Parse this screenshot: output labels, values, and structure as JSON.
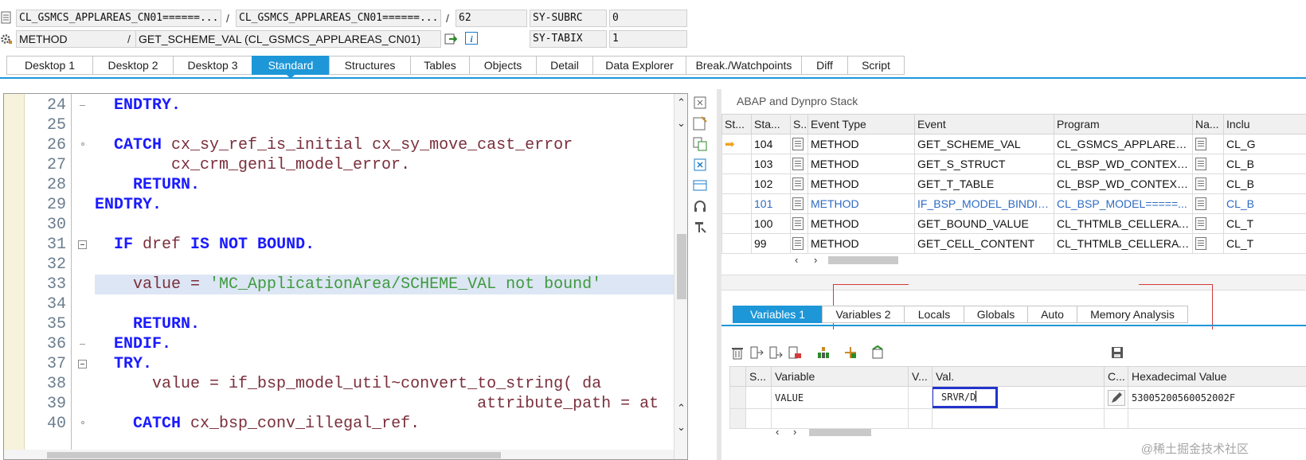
{
  "header": {
    "row1": {
      "program1": "CL_GSMCS_APPLAREAS_CN01======...",
      "slash1": "/",
      "program2": "CL_GSMCS_APPLAREAS_CN01======...",
      "slash2": "/",
      "line_no": "62",
      "sysvar_label": "SY-SUBRC",
      "sysvar_value": "0"
    },
    "row2": {
      "type": "METHOD",
      "slash": "/",
      "method": "GET_SCHEME_VAL (CL_GSMCS_APPLAREAS_CN01)",
      "sysvar_label": "SY-TABIX",
      "sysvar_value": "1"
    }
  },
  "tabs": [
    "Desktop 1",
    "Desktop 2",
    "Desktop 3",
    "Standard",
    "Structures",
    "Tables",
    "Objects",
    "Detail",
    "Data Explorer",
    "Break./Watchpoints",
    "Diff",
    "Script"
  ],
  "active_tab": "Standard",
  "editor": {
    "lines": [
      {
        "n": "24",
        "indent": "  ",
        "parts": [
          {
            "t": "ENDTRY",
            "c": "kw"
          },
          {
            "t": ".",
            "c": "kw"
          }
        ]
      },
      {
        "n": "25",
        "indent": "",
        "parts": []
      },
      {
        "n": "26",
        "indent": "  ",
        "parts": [
          {
            "t": "CATCH",
            "c": "kw"
          },
          {
            "t": " cx_sy_ref_is_initial cx_sy_move_cast_error",
            "c": "id"
          }
        ]
      },
      {
        "n": "27",
        "indent": "        ",
        "parts": [
          {
            "t": "cx_crm_genil_model_error.",
            "c": "id"
          }
        ]
      },
      {
        "n": "28",
        "indent": "    ",
        "parts": [
          {
            "t": "RETURN",
            "c": "kw"
          },
          {
            "t": ".",
            "c": "kw"
          }
        ]
      },
      {
        "n": "29",
        "indent": "",
        "parts": [
          {
            "t": "ENDTRY",
            "c": "kw"
          },
          {
            "t": ".",
            "c": "kw"
          }
        ]
      },
      {
        "n": "30",
        "indent": "",
        "parts": []
      },
      {
        "n": "31",
        "indent": "  ",
        "parts": [
          {
            "t": "IF",
            "c": "kw"
          },
          {
            "t": " dref ",
            "c": "id"
          },
          {
            "t": "IS NOT BOUND",
            "c": "kw"
          },
          {
            "t": ".",
            "c": "kw"
          }
        ]
      },
      {
        "n": "32",
        "indent": "",
        "parts": []
      },
      {
        "n": "33",
        "indent": "    ",
        "parts": [
          {
            "t": "value = ",
            "c": "id"
          },
          {
            "t": "'MC_ApplicationArea/SCHEME_VAL not bound'",
            "c": "str"
          }
        ]
      },
      {
        "n": "34",
        "indent": "",
        "parts": []
      },
      {
        "n": "35",
        "indent": "    ",
        "parts": [
          {
            "t": "RETURN",
            "c": "kw"
          },
          {
            "t": ".",
            "c": "kw"
          }
        ]
      },
      {
        "n": "36",
        "indent": "  ",
        "parts": [
          {
            "t": "ENDIF",
            "c": "kw"
          },
          {
            "t": ".",
            "c": "kw"
          }
        ]
      },
      {
        "n": "37",
        "indent": "  ",
        "parts": [
          {
            "t": "TRY",
            "c": "kw"
          },
          {
            "t": ".",
            "c": "kw"
          }
        ]
      },
      {
        "n": "38",
        "indent": "      ",
        "parts": [
          {
            "t": "value = if_bsp_model_util~convert_to_string( da",
            "c": "id"
          }
        ]
      },
      {
        "n": "39",
        "indent": "                                        ",
        "parts": [
          {
            "t": "attribute_path = at",
            "c": "id"
          }
        ]
      },
      {
        "n": "40",
        "indent": "    ",
        "parts": [
          {
            "t": "CATCH",
            "c": "kw"
          },
          {
            "t": " cx_bsp_conv_illegal_ref.",
            "c": "id"
          }
        ]
      }
    ]
  },
  "stack": {
    "title": "ABAP and Dynpro Stack",
    "columns": [
      "St...",
      "Sta...",
      "S...",
      "Event Type",
      "Event",
      "Program",
      "Na...",
      "Inclu"
    ],
    "rows": [
      {
        "level": "104",
        "type": "METHOD",
        "event": "GET_SCHEME_VAL",
        "program": "CL_GSMCS_APPLAREAS_...",
        "incl": "CL_G",
        "current": true,
        "selected": false
      },
      {
        "level": "103",
        "type": "METHOD",
        "event": "GET_S_STRUCT",
        "program": "CL_BSP_WD_CONTEXT_...",
        "incl": "CL_B",
        "current": false,
        "selected": false
      },
      {
        "level": "102",
        "type": "METHOD",
        "event": "GET_T_TABLE",
        "program": "CL_BSP_WD_CONTEXT_...",
        "incl": "CL_B",
        "current": false,
        "selected": false
      },
      {
        "level": "101",
        "type": "METHOD",
        "event": "IF_BSP_MODEL_BINDING...",
        "program": "CL_BSP_MODEL=====...",
        "incl": "CL_B",
        "current": false,
        "selected": true
      },
      {
        "level": "100",
        "type": "METHOD",
        "event": "GET_BOUND_VALUE",
        "program": "CL_THTMLB_CELLERATO...",
        "incl": "CL_T",
        "current": false,
        "selected": false
      },
      {
        "level": "99",
        "type": "METHOD",
        "event": "GET_CELL_CONTENT",
        "program": "CL_THTMLB_CELLERATO...",
        "incl": "CL_T",
        "current": false,
        "selected": false
      }
    ]
  },
  "var_tabs": [
    "Variables 1",
    "Variables 2",
    "Locals",
    "Globals",
    "Auto",
    "Memory Analysis"
  ],
  "active_var_tab": "Variables 1",
  "variables": {
    "columns": [
      "S...",
      "Variable",
      "V...",
      "Val.",
      "C...",
      "Hexadecimal Value"
    ],
    "rows": [
      {
        "variable": "VALUE",
        "value": "SRVR/D",
        "hex": "53005200560052002F"
      }
    ]
  },
  "watermark": "@稀土掘金技术社区",
  "colors": {
    "accent": "#1d97d8",
    "keyword": "#1a1aff",
    "string": "#3f9a3f",
    "identifier": "#7a2f3c",
    "highlight_box": "#2233cc"
  }
}
